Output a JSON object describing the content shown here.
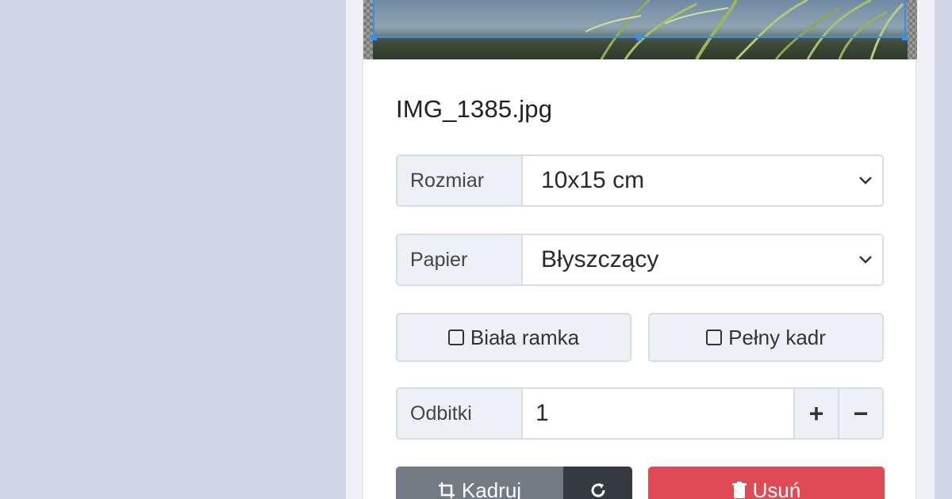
{
  "photo": {
    "filename": "IMG_1385.jpg"
  },
  "options": {
    "size_label": "Rozmiar",
    "size_value": "10x15 cm",
    "paper_label": "Papier",
    "paper_value": "Błyszczący"
  },
  "toggles": {
    "white_border": "Biała ramka",
    "full_frame": "Pełny kadr"
  },
  "quantity": {
    "label": "Odbitki",
    "value": "1",
    "plus": "+",
    "minus": "−"
  },
  "actions": {
    "crop": "Kadruj",
    "delete": "Usuń"
  },
  "icons": {
    "crop": "crop-icon",
    "rotate": "rotate-icon",
    "trash": "trash-icon",
    "chevron": "chevron-down-icon",
    "checkbox": "checkbox-icon"
  },
  "colors": {
    "page_bg": "#cfd6e6",
    "crop_btn": "#727a84",
    "rotate_btn": "#343a40",
    "delete_btn": "#e04a55",
    "crop_frame": "#3a8ee6"
  }
}
